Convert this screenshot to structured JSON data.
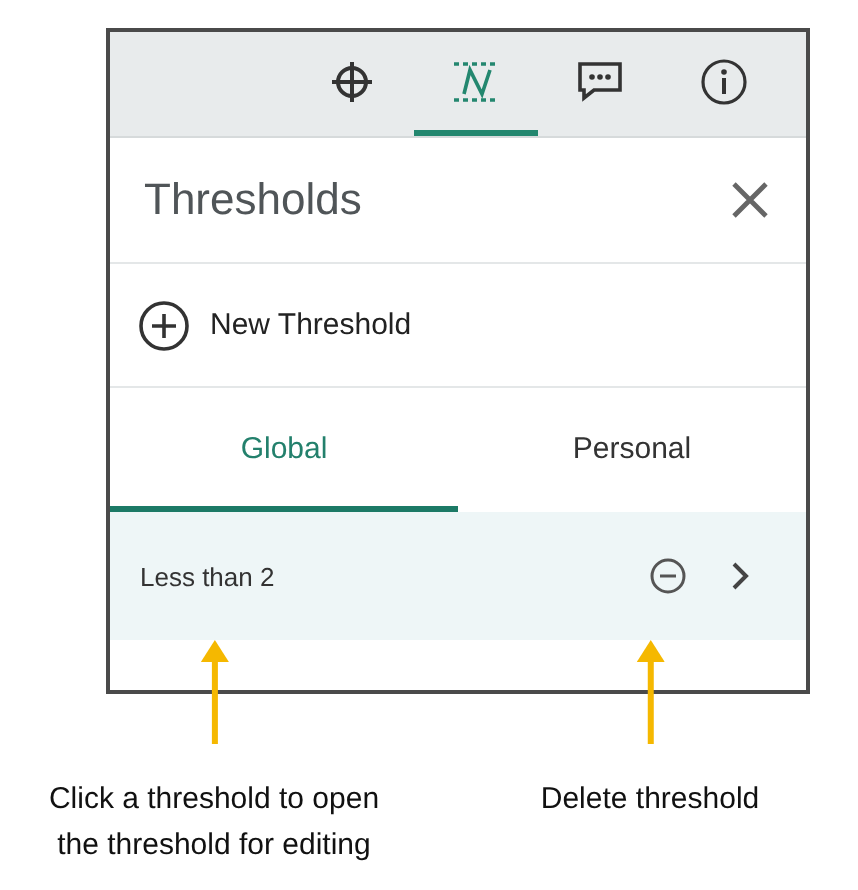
{
  "toolbar": [
    {
      "kind": "crosshair",
      "selected": false
    },
    {
      "kind": "threshold",
      "selected": true
    },
    {
      "kind": "chat",
      "selected": false
    },
    {
      "kind": "info",
      "selected": false
    }
  ],
  "panel": {
    "title": "Thresholds",
    "new_button": "New Threshold"
  },
  "tabs": [
    {
      "label": "Global",
      "selected": true
    },
    {
      "label": "Personal",
      "selected": false
    }
  ],
  "thresholds": [
    {
      "name": "Less than 2"
    }
  ],
  "annotations": [
    {
      "text": "Click a threshold to open\nthe threshold for editing"
    },
    {
      "text": "Delete threshold"
    }
  ]
}
